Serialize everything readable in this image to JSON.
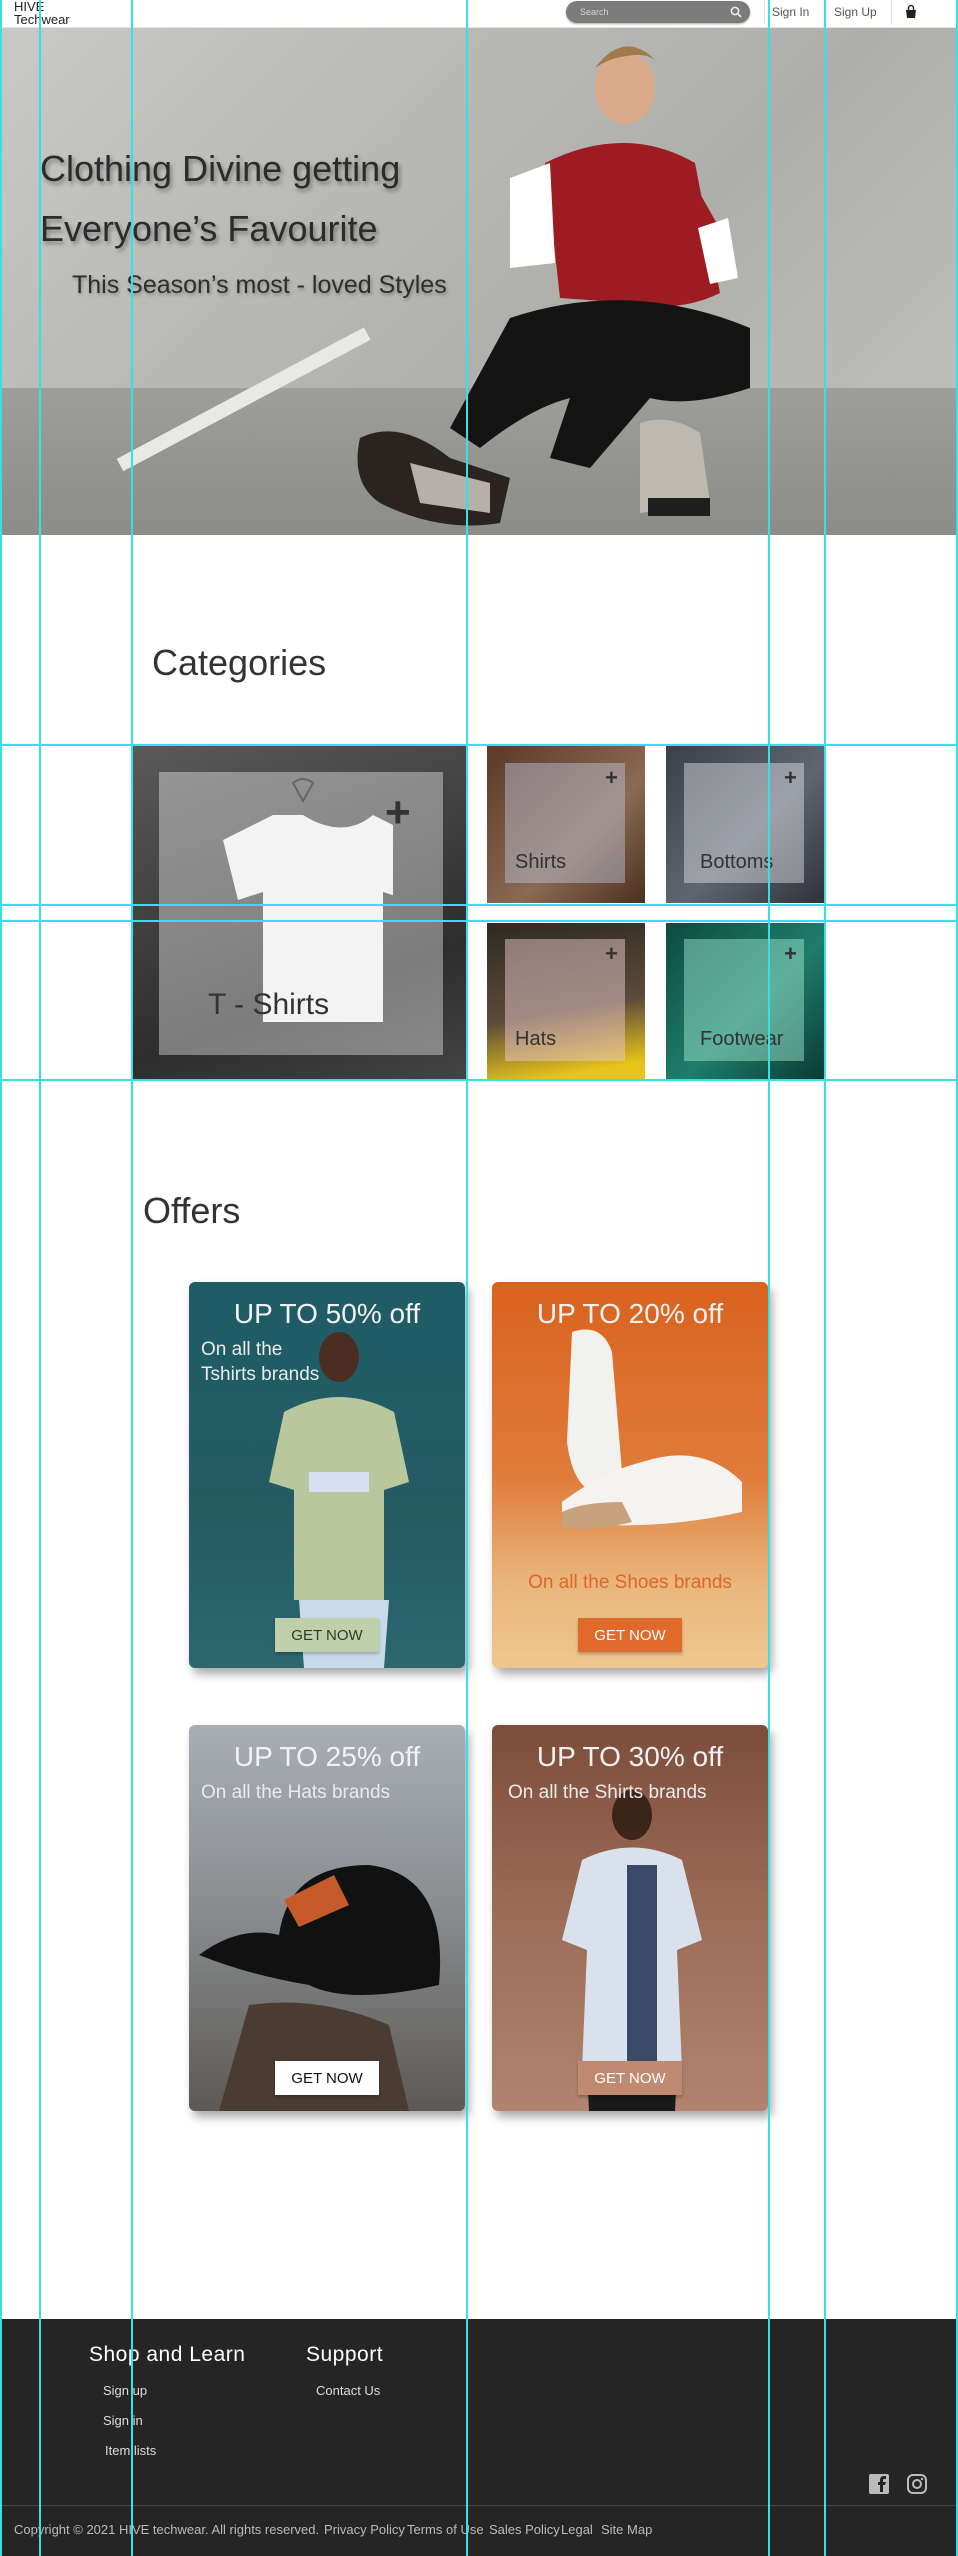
{
  "header": {
    "logo_line1": "HIVE",
    "logo_line2": "Techwear",
    "search_placeholder": "Search",
    "sign_in": "Sign In",
    "sign_up": "Sign Up"
  },
  "hero": {
    "headline_line1": "Clothing Divine getting",
    "headline_line2": "Everyone’s Favourite",
    "subheadline": "This Season’s most - loved Styles"
  },
  "categories": {
    "title": "Categories",
    "items": [
      {
        "label": "T - Shirts"
      },
      {
        "label": "Shirts"
      },
      {
        "label": "Bottoms"
      },
      {
        "label": "Hats"
      },
      {
        "label": "Footwear"
      }
    ]
  },
  "offers": {
    "title": "Offers",
    "items": [
      {
        "headline": "UP TO 50% off",
        "desc_line1": "On all the",
        "desc_line2": "Tshirts brands",
        "button": "GET NOW"
      },
      {
        "headline": "UP TO 20% off",
        "desc": "On all the Shoes brands",
        "button": "GET NOW"
      },
      {
        "headline": "UP TO 25% off",
        "desc": "On all the Hats brands",
        "button": "GET NOW"
      },
      {
        "headline": "UP TO 30% off",
        "desc": "On all the Shirts brands",
        "button": "GET NOW"
      }
    ]
  },
  "footer": {
    "shop_title": "Shop and Learn",
    "shop_links": [
      "Sign up",
      "Sign in",
      "Item lists"
    ],
    "support_title": "Support",
    "support_links": [
      "Contact Us"
    ],
    "copyright": "Copyright © 2021 HIVE techwear. All rights reserved.",
    "legal_links": [
      "Privacy Policy",
      "Terms of Use",
      "Sales Policy",
      "Legal",
      "Site Map"
    ]
  },
  "colors": {
    "guide": "#35e1e8",
    "footer_bg": "#252525",
    "offer_shoes_accent": "#e06a2c"
  },
  "icons": [
    "search-icon",
    "shopping-bag-icon",
    "plus-icon",
    "facebook-icon",
    "instagram-icon"
  ]
}
